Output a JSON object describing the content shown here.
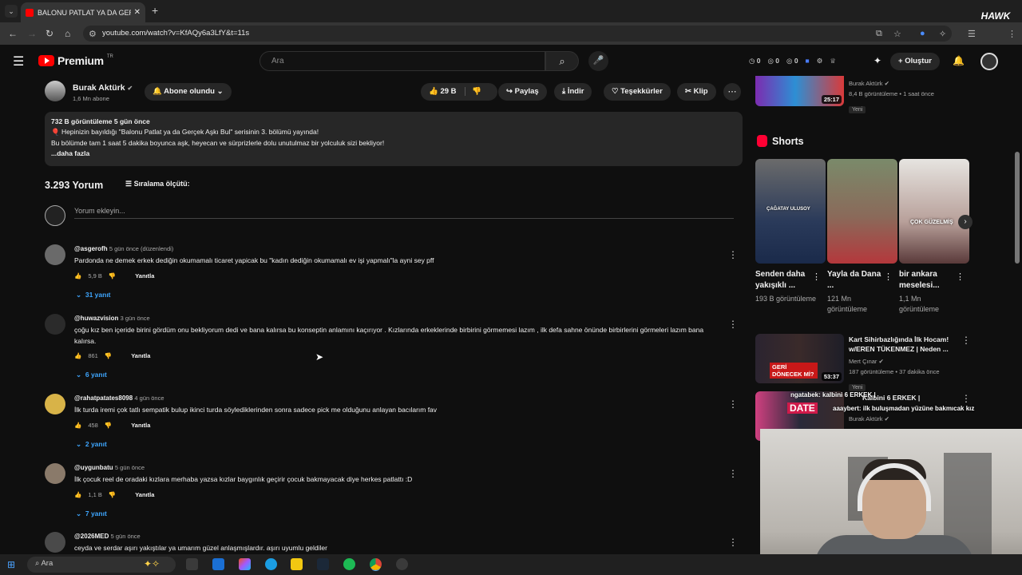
{
  "browser": {
    "tab_title": "BALONU PATLAT YA DA GERÇEK",
    "url": "youtube.com/watch?v=KfAQy6a3LfY&t=11s"
  },
  "youtube_header": {
    "logo": "Premium",
    "region": "TR",
    "search_placeholder": "Ara",
    "ext_counts": [
      "0",
      "0",
      "0"
    ],
    "create_label": "Oluştur"
  },
  "channel": {
    "name": "Burak Aktürk",
    "subs": "1,6 Mn abone",
    "subscribe_label": "Abone olundu",
    "likes": "29 B",
    "share_label": "Paylaş",
    "download_label": "İndir",
    "thanks_label": "Teşekkürler",
    "clip_label": "Klip"
  },
  "description": {
    "stats": "732 B görüntüleme  5 gün önce",
    "line1": "🎈 Hepinizin bayıldığı \"Balonu Patlat ya da Gerçek Aşkı Bul\" serisinin 3. bölümü yayında!",
    "line2": "Bu bölümde tam 1 saat 5 dakika boyunca aşk, heyecan ve sürprizlerle dolu unutulmaz bir yolculuk sizi bekliyor!",
    "more": "...daha fazla"
  },
  "comments_header": {
    "count": "3.293 Yorum",
    "sort_label": "Sıralama ölçütü:",
    "add_placeholder": "Yorum ekleyin..."
  },
  "comments": [
    {
      "user": "@asgerofh",
      "time": "5 gün önce (düzenlendi)",
      "text": "Pardonda ne demek erkek dediğin okumamalı ticaret yapicak bu \"kadın dediğin okumamalı ev işi yapmalı\"la ayni sey pff",
      "likes": "5,9 B",
      "reply_label": "Yanıtla",
      "replies": "31 yanıt"
    },
    {
      "user": "@huwazvision",
      "time": "3 gün önce",
      "text": "çoğu kız ben içeride birini gördüm onu bekliyorum dedi ve bana kalırsa bu konseptin anlamını kaçırıyor . Kızlarında erkeklerinde birbirini görmemesi lazım , ilk defa sahne önünde birbirlerini görmeleri lazım bana kalırsa.",
      "likes": "861",
      "reply_label": "Yanıtla",
      "replies": "6 yanıt"
    },
    {
      "user": "@rahatpatates8098",
      "time": "4 gün önce",
      "text": "İlk turda iremi çok tatlı sempatik bulup ikinci turda söylediklerinden sonra sadece pick me olduğunu anlayan bacılarım fav",
      "likes": "458",
      "reply_label": "Yanıtla",
      "replies": "2 yanıt"
    },
    {
      "user": "@uygunbatu",
      "time": "5 gün önce",
      "text": "İlk çocuk reel de oradaki kızlara merhaba yazsa kızlar baygınlık geçirir çocuk bakmayacak diye herkes patlattı :D",
      "likes": "1,1 B",
      "reply_label": "Yanıtla",
      "replies": "7 yanıt"
    },
    {
      "user": "@2026MED",
      "time": "5 gün önce",
      "text": "ceyda ve serdar aşırı yakıştılar ya umarım güzel anlaşmışlardır. aşırı uyumlu geldiler",
      "likes": "",
      "reply_label": "",
      "replies": ""
    }
  ],
  "sidebar": {
    "top_video": {
      "channel": "Burak Aktürk",
      "meta": "8,4 B görüntüleme • 1 saat önce",
      "badge": "Yeni",
      "duration": "25:17"
    },
    "shorts_title": "Shorts",
    "shorts": [
      {
        "title": "Senden daha yakışıklı ...",
        "views": "193 B görüntüleme",
        "overlay": "ÇAĞATAY ULUSOY"
      },
      {
        "title": "Yayla da Dana ...",
        "views": "121 Mn görüntüleme",
        "overlay": ""
      },
      {
        "title": "bir ankara meselesi...",
        "views": "1,1 Mn görüntüleme",
        "overlay": "ÇOK GÜZELMİŞ"
      }
    ],
    "video2": {
      "title": "Kart Sihirbazlığında İlk Hocam! w/EREN TÜKENMEZ | Neden ...",
      "channel": "Mert Çınar",
      "meta": "187 görüntüleme • 37 dakika önce",
      "badge": "Yeni",
      "duration": "53:37",
      "thumb_text": "GERİ DÖNECEK Mİ?"
    },
    "video3": {
      "title": "Kalbini 6 ERKEK |",
      "channel": "Burak Aktürk",
      "thumb_text": "DATE"
    }
  },
  "stream_overlay": {
    "chat1": "ngatabek: kalbini 6 ERKEK |",
    "chat2": "aaaybert: ilk buluşmadan yüzüne bakmıcak kız",
    "brand": "HAWK"
  },
  "taskbar": {
    "search_label": "Ara"
  },
  "colors": {
    "accent": "#ff0000",
    "link": "#3ea6ff",
    "bg": "#0f0f0f",
    "surface": "#272727"
  }
}
